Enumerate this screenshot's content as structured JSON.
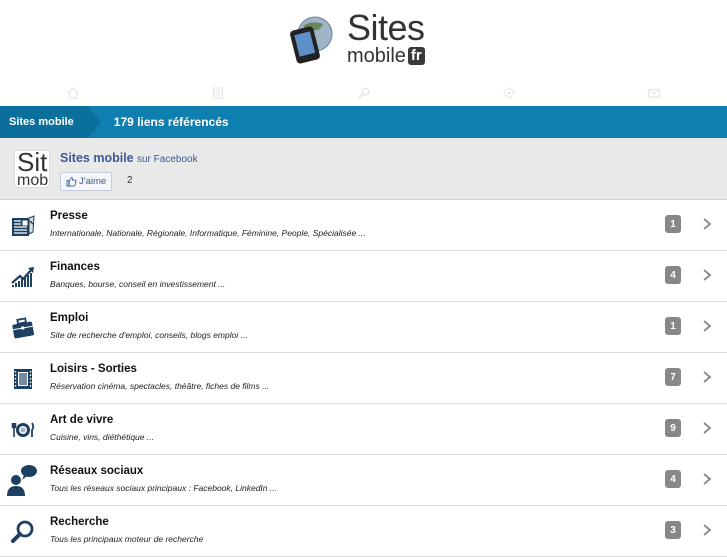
{
  "logo": {
    "line1": "Sites",
    "line2": "mobile",
    "tld": "fr"
  },
  "nav": [
    {
      "name": "nav-home",
      "icon": "home-icon"
    },
    {
      "name": "nav-list",
      "icon": "list-icon"
    },
    {
      "name": "nav-search",
      "icon": "search-icon"
    },
    {
      "name": "nav-settings",
      "icon": "gear-icon"
    },
    {
      "name": "nav-mail",
      "icon": "mail-icon"
    }
  ],
  "breadcrumb": {
    "home": "Sites mobile",
    "current": "179 liens référencés"
  },
  "facebook": {
    "thumb_top": "Sit",
    "thumb_bottom": "mob",
    "page_name": "Sites mobile",
    "suffix": "sur Facebook",
    "like_label": "J'aime",
    "like_count": "2"
  },
  "categories": [
    {
      "title": "Presse",
      "subtitle": "Internationale, Nationale, Régionale, Informatique, Féminine, People, Spécialisée ...",
      "count": "1",
      "icon": "newspaper-icon"
    },
    {
      "title": "Finances",
      "subtitle": "Banques, bourse, conseil en investissement ...",
      "count": "4",
      "icon": "chart-growth-icon"
    },
    {
      "title": "Emploi",
      "subtitle": "Site de recherche d'emploi, conseils, blogs emploi ...",
      "count": "1",
      "icon": "briefcase-icon"
    },
    {
      "title": "Loisirs - Sorties",
      "subtitle": "Réservation cinéma, spectacles, théâtre, fiches de films ...",
      "count": "7",
      "icon": "film-icon"
    },
    {
      "title": "Art de vivre",
      "subtitle": "Cuisine, vins, diéthétique ...",
      "count": "9",
      "icon": "plate-cutlery-icon"
    },
    {
      "title": "Réseaux sociaux",
      "subtitle": "Tous les réseaux sociaux principaux : Facebook, LinkedIn  ...",
      "count": "4",
      "icon": "social-chat-icon"
    },
    {
      "title": "Recherche",
      "subtitle": "Tous les principaux moteur de recherche",
      "count": "3",
      "icon": "magnifier-icon"
    }
  ],
  "colors": {
    "accent": "#0f7fb0",
    "accent_dark": "#0b6f9c",
    "badge": "#888888",
    "facebook": "#3b5998",
    "icon_dark": "#1c3f63"
  }
}
